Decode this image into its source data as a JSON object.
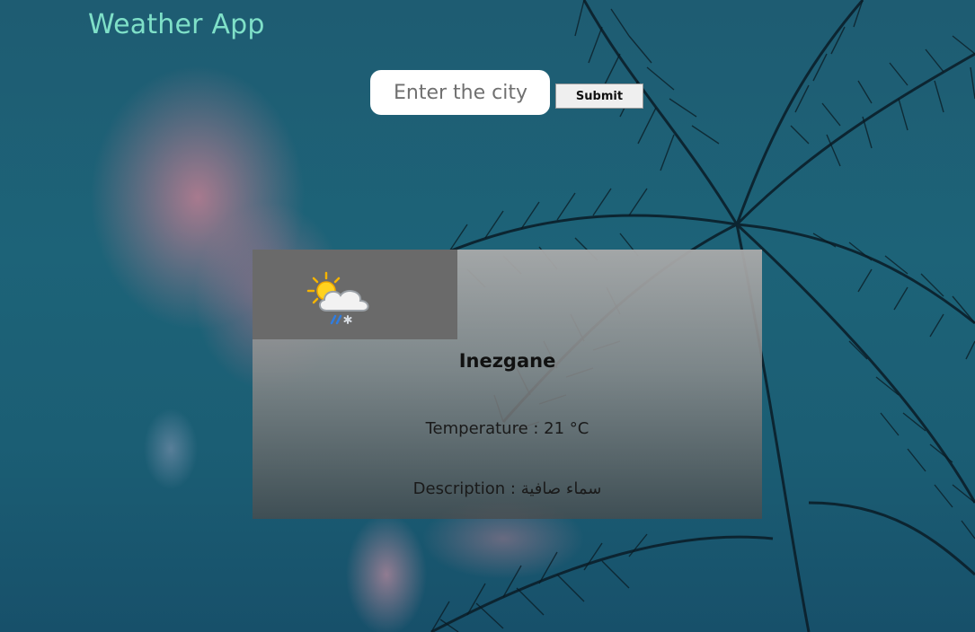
{
  "header": {
    "title": "Weather App"
  },
  "search": {
    "placeholder": "Enter the city",
    "value": "",
    "submit_label": "Submit"
  },
  "weather_card": {
    "icon": "sun-cloud-snow-rain-icon",
    "city": "Inezgane",
    "temperature_label": "Temperature : ",
    "temperature_value": "21 °C",
    "description_label": "Description : ",
    "description_value": "سماء صافية"
  },
  "colors": {
    "title": "#7fe0c8",
    "sky": "#1d6378",
    "card_icon_box": "#6a6a6a"
  }
}
